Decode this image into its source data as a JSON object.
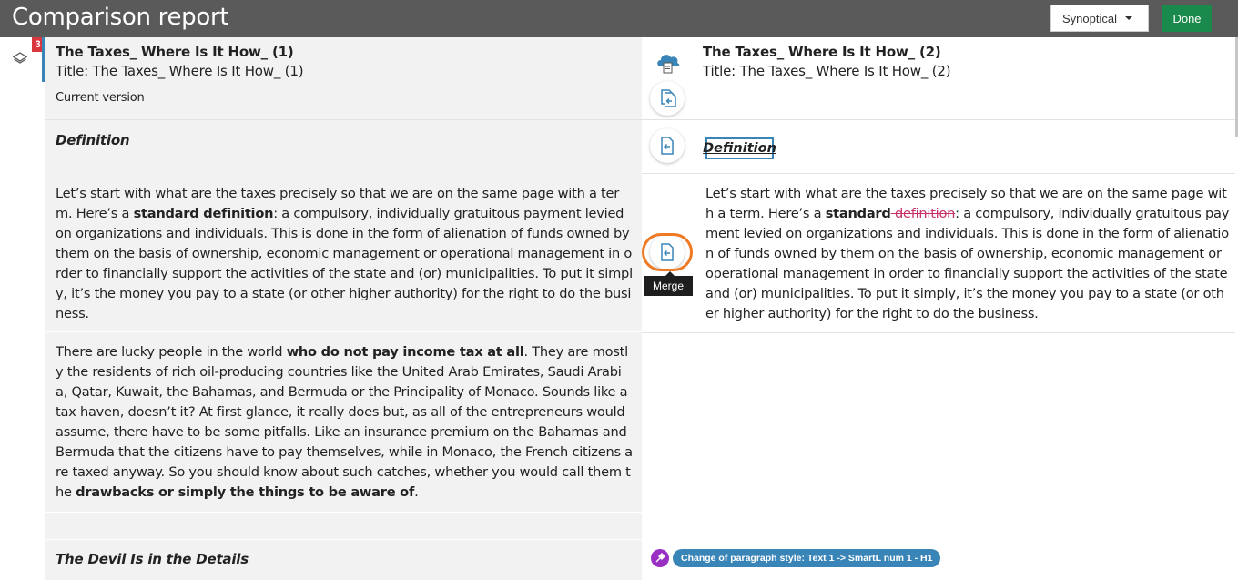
{
  "header": {
    "title": "Comparison report",
    "mode_selected": "Synoptical",
    "done_label": "Done"
  },
  "gutter": {
    "badge_count": "3",
    "icon": "layers-icon"
  },
  "left": {
    "doc_name": "The Taxes_ Where Is It How_ (1)",
    "doc_title": "Title: The Taxes_ Where Is It How_ (1)",
    "version_label": "Current version",
    "heading_definition": "Definition",
    "p1": {
      "a": "Let’s start with what are the taxes precisely so that we are on the same page with a term. Here’s a ",
      "b": "standard definition",
      "c": ": a compulsory, individually gratuitous payment levied on organizations and individuals. This is done in the form of alienation of funds owned by them on the basis of ownership, economic management or operational management in order to financially support the activities of the state and (or) municipalities. To put it simply, it’s the money you pay to a state (or other higher authority) for the right to do the business."
    },
    "p2": {
      "a": "There are lucky people in the world ",
      "b": "who do not pay income tax at all",
      "c": ". They are mostly the residents of rich oil-producing countries like the United Arab Emirates, Saudi Arabia, Qatar, Kuwait, the Bahamas, and Bermuda or the Principality of Monaco. Sounds like a tax haven, doesn’t it? At first glance, it really does but, as all of the entrepreneurs would assume, there have to be some pitfalls. Like an insurance premium on the Bahamas and Bermuda that the citizens have to pay themselves, while in Monaco, the French citizens are taxed anyway. So you should know about such catches, whether you would call them the ",
      "d": "drawbacks or simply the things to be aware of",
      "e": "."
    },
    "heading_devil": "The Devil Is in the Details"
  },
  "right": {
    "doc_name": "The Taxes_ Where Is It How_ (2)",
    "doc_title": "Title: The Taxes_ Where Is It How_ (2)",
    "heading_definition": "Definition",
    "p1": {
      "a": "Let’s start with what are the taxes precisely so that we are on the same page with a term. Here’s a ",
      "b": "standard",
      "del": " definition",
      "c": ": a compulsory, individually gratuitous payment levied on organizations and individuals. This is done in the form of alienation of funds owned by them on the basis of ownership, economic management or operational management in order to financially support the activities of the state and (or) municipalities. To put it simply, it’s the money you pay to a state (or other higher authority) for the right to do the business."
    },
    "style_change": "Change of paragraph style:  Text 1  ->  SmartL num 1 - H1"
  },
  "tooltip": "Merge",
  "colors": {
    "header_bg": "#5a5a5a",
    "done_green": "#1a8a4c",
    "accent_blue": "#3a85b8",
    "deletion": "#c8326a",
    "highlight_orange": "#ef7a23",
    "badge_red": "#d9363e",
    "style_purple": "#9a2fc4"
  }
}
